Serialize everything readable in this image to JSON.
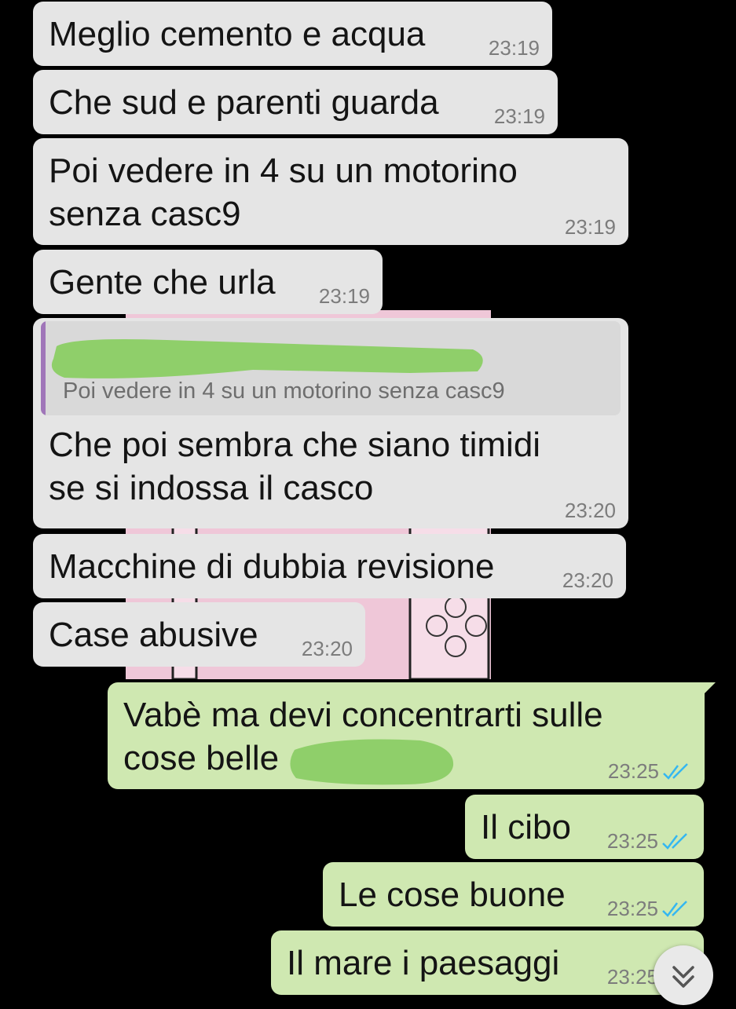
{
  "messages": [
    {
      "text": "Meglio cemento e acqua",
      "time": "23:19"
    },
    {
      "text": "Che sud e parenti guarda",
      "time": "23:19"
    },
    {
      "text_line1": "Poi vedere in 4 su un motorino",
      "text_line2": "senza casc9",
      "time": "23:19"
    },
    {
      "text": "Gente che urla",
      "time": "23:19"
    },
    {
      "quote_text": "Poi vedere in 4 su un motorino senza casc9",
      "text_line1": "Che poi sembra che siano timidi",
      "text_line2": "se si indossa il casco",
      "time": "23:20"
    },
    {
      "text": "Macchine di dubbia revisione",
      "time": "23:20"
    },
    {
      "text": "Case abusive",
      "time": "23:20"
    }
  ],
  "sent": [
    {
      "text_line1": "Vabè ma devi concentrarti sulle",
      "text_line2": "cose belle",
      "time": "23:25",
      "status": "read"
    },
    {
      "text": "Il cibo",
      "time": "23:25",
      "status": "read"
    },
    {
      "text": "Le cose buone",
      "time": "23:25",
      "status": "read"
    },
    {
      "text": "Il mare i paesaggi",
      "time": "23:25",
      "status": "read"
    }
  ],
  "colors": {
    "incoming": "#e5e5e5",
    "outgoing": "#cfe8b1",
    "read_ticks": "#34b7f1",
    "quote_bar": "#a076b9",
    "redaction": "#8fcf6a"
  },
  "scroll_button": {
    "icon": "double-chevron-down-icon"
  }
}
